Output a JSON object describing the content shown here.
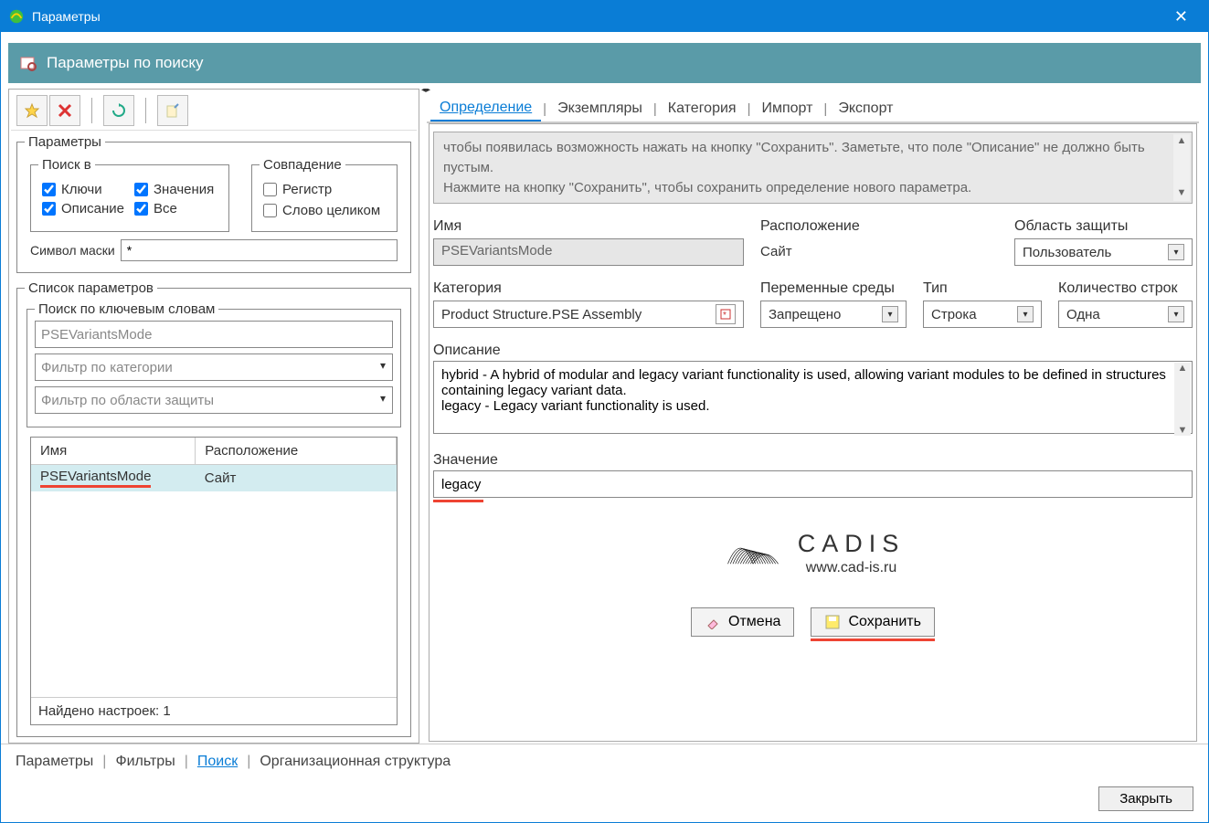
{
  "window": {
    "title": "Параметры"
  },
  "subheader": {
    "title": "Параметры по поиску"
  },
  "left": {
    "params_legend": "Параметры",
    "search_in_legend": "Поиск в",
    "search_in": {
      "keys": "Ключи",
      "values": "Значения",
      "desc": "Описание",
      "all": "Все"
    },
    "match_legend": "Совпадение",
    "match": {
      "case": "Регистр",
      "whole": "Слово целиком"
    },
    "mask_label": "Символ маски",
    "mask_value": "*",
    "list_legend": "Список параметров",
    "keyword_legend": "Поиск по ключевым словам",
    "keyword_value": "PSEVariantsMode",
    "cat_filter": "Фильтр по категории",
    "prot_filter": "Фильтр по области защиты",
    "table": {
      "headers": {
        "name": "Имя",
        "loc": "Расположение"
      },
      "rows": [
        {
          "name": "PSEVariantsMode",
          "loc": "Сайт"
        }
      ]
    },
    "found": "Найдено настроек: 1"
  },
  "right": {
    "tabs": {
      "def": "Определение",
      "inst": "Экземпляры",
      "cat": "Категория",
      "imp": "Импорт",
      "exp": "Экспорт"
    },
    "info1": "чтобы появилась возможность нажать на кнопку \"Сохранить\". Заметьте, что поле \"Описание\" не должно быть пустым.",
    "info2": "Нажмите на кнопку \"Сохранить\", чтобы сохранить определение нового параметра.",
    "name_label": "Имя",
    "name_value": "PSEVariantsMode",
    "loc_label": "Расположение",
    "loc_value": "Сайт",
    "prot_label": "Область защиты",
    "prot_value": "Пользователь",
    "cat_label": "Категория",
    "cat_value": "Product Structure.PSE Assembly",
    "env_label": "Переменные среды",
    "env_value": "Запрещено",
    "type_label": "Тип",
    "type_value": "Строка",
    "lines_label": "Количество строк",
    "lines_value": "Одна",
    "desc_label": "Описание",
    "desc_value": "hybrid - A hybrid of modular and legacy variant functionality is used, allowing variant modules to be defined in structures containing legacy variant data.\nlegacy - Legacy variant functionality is used.",
    "val_label": "Значение",
    "val_value": "legacy",
    "logo_text": "CADIS",
    "logo_url": "www.cad-is.ru",
    "cancel": "Отмена",
    "save": "Сохранить"
  },
  "bottom_tabs": {
    "params": "Параметры",
    "filters": "Фильтры",
    "search": "Поиск",
    "org": "Организационная структура"
  },
  "close": "Закрыть"
}
